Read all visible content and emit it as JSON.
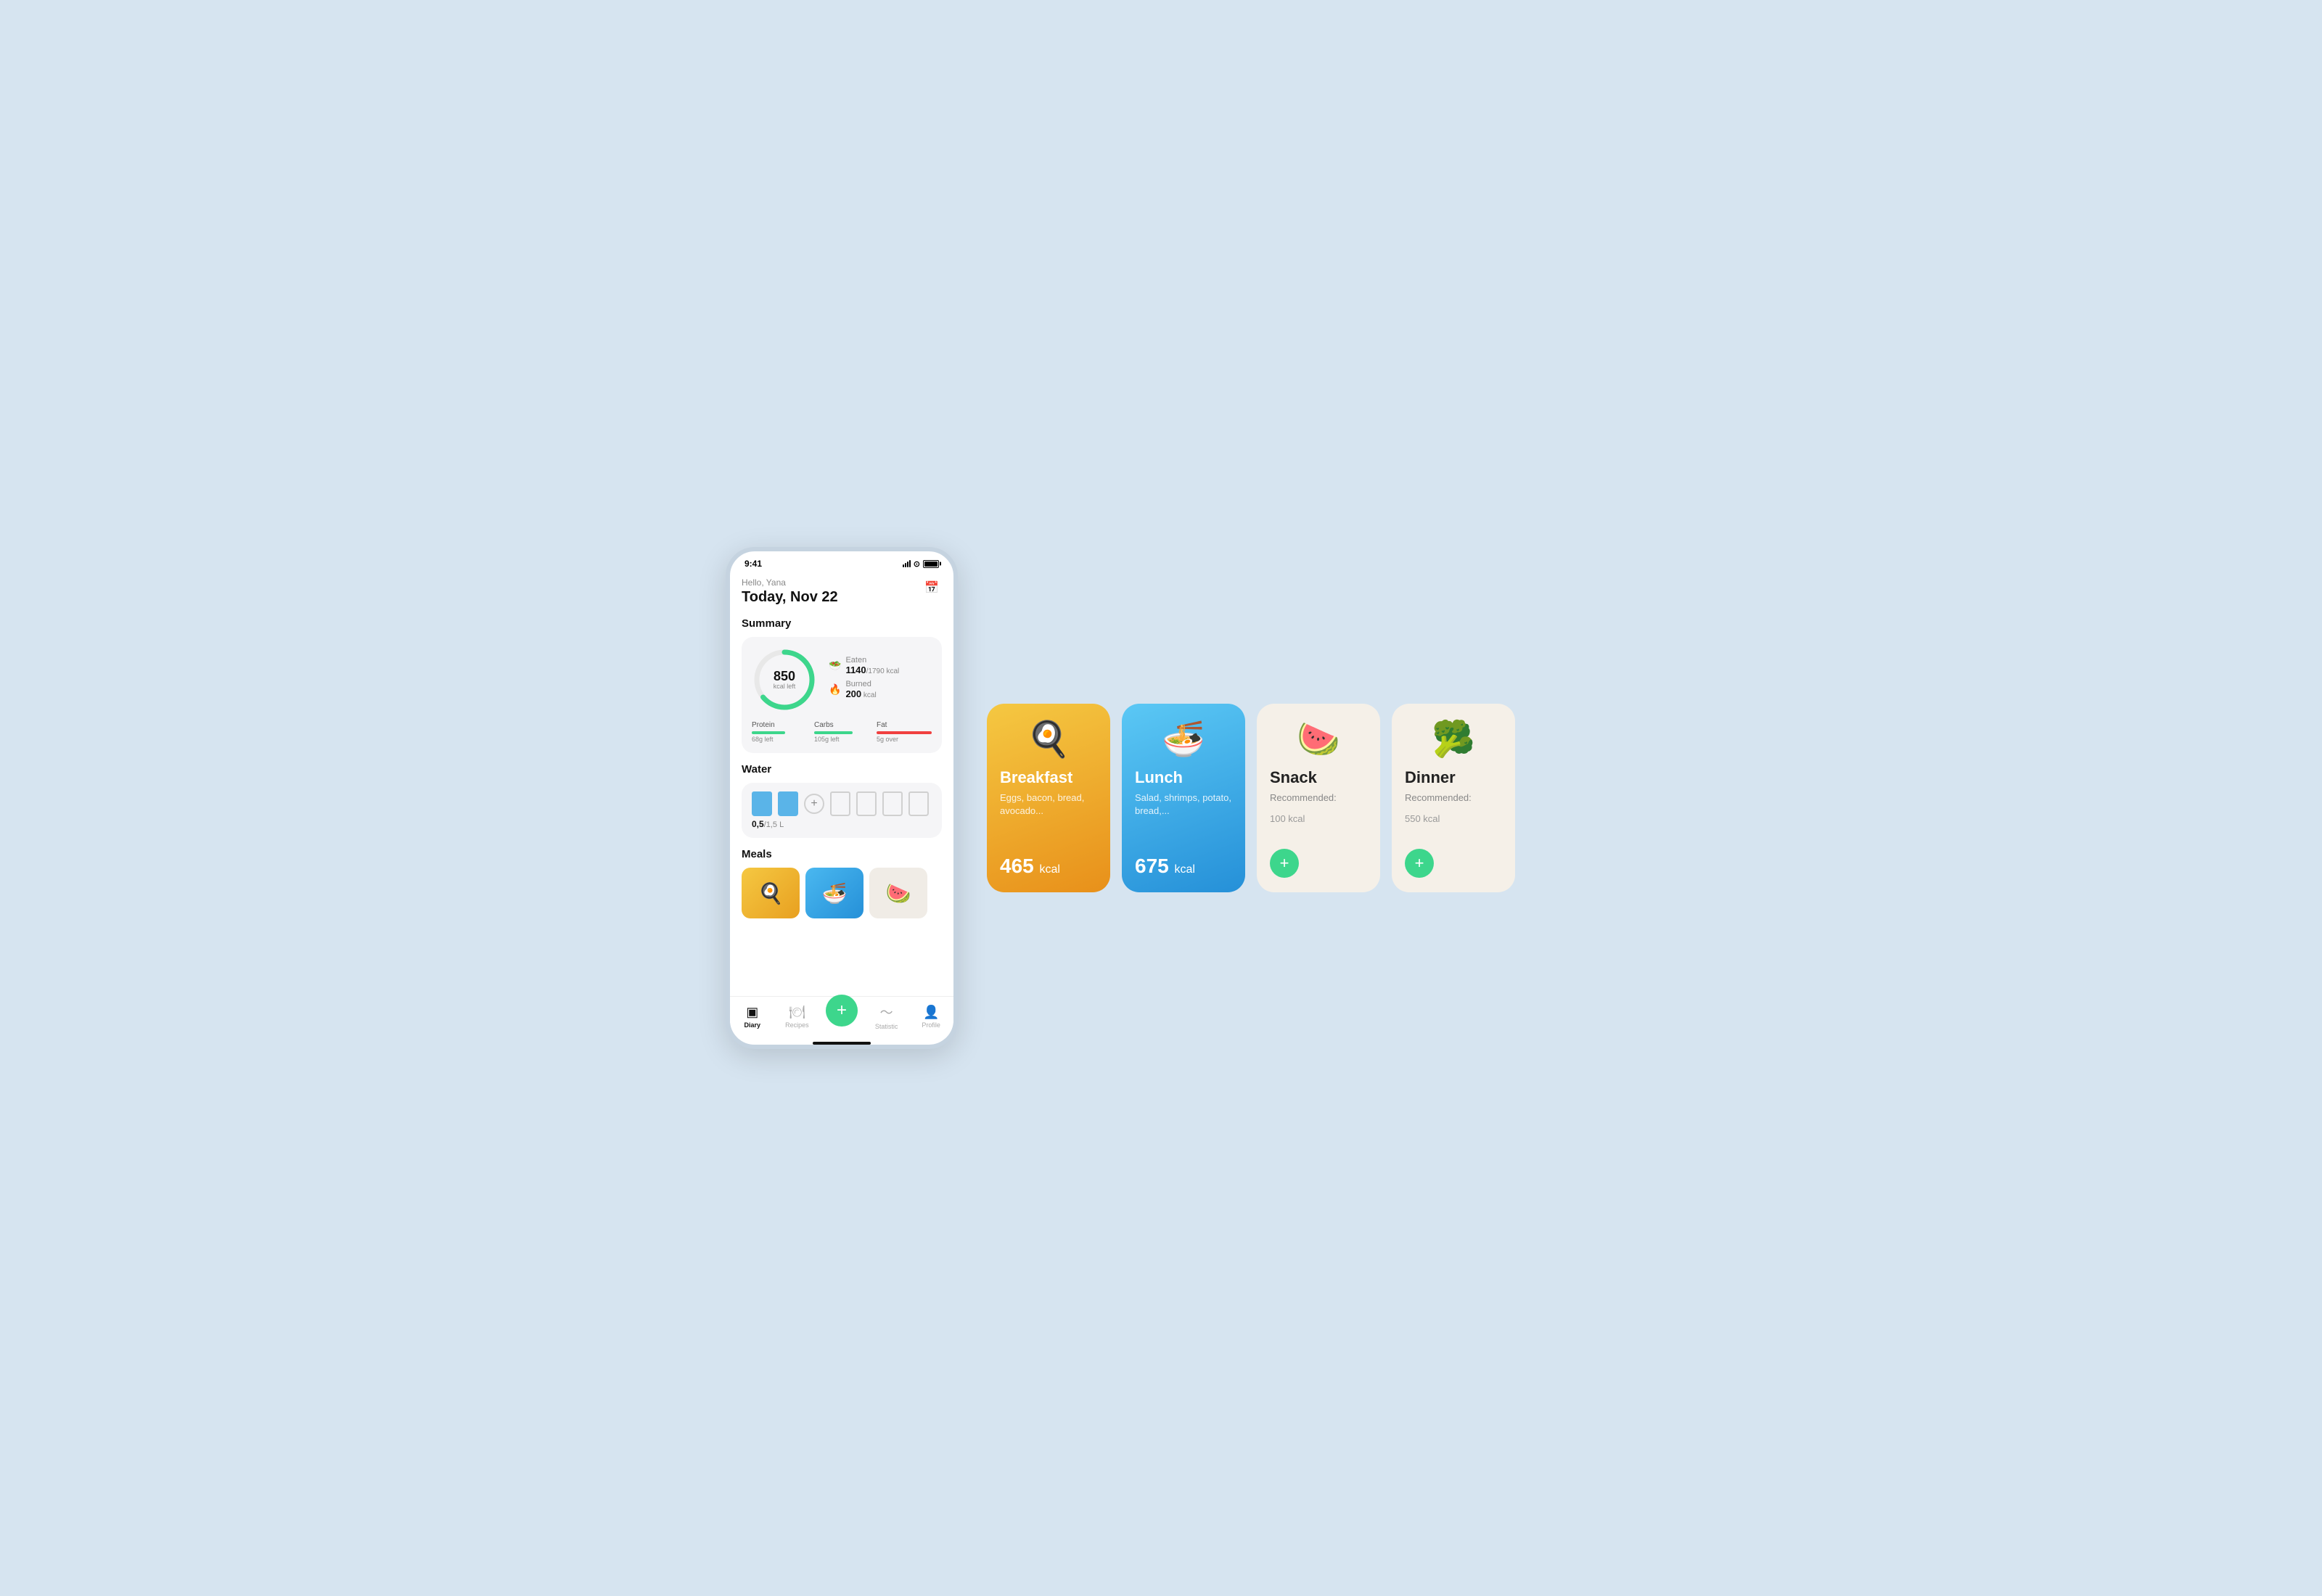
{
  "app": {
    "background_color": "#d6e4f0"
  },
  "status_bar": {
    "time": "9:41",
    "signal": "signal",
    "wifi": "wifi",
    "battery": "battery"
  },
  "header": {
    "greeting": "Hello, Yana",
    "date": "Today, Nov 22"
  },
  "summary": {
    "section_title": "Summary",
    "kcal_left": "850",
    "kcal_left_label": "kcal left",
    "eaten_label": "Eaten",
    "eaten_value": "1140",
    "eaten_total": "1790",
    "eaten_unit": "kcal",
    "burned_label": "Burned",
    "burned_value": "200",
    "burned_unit": "kcal",
    "donut_progress": 64,
    "macros": [
      {
        "name": "Protein",
        "color": "#3dd68c",
        "left": "68g left",
        "progress": 60
      },
      {
        "name": "Carbs",
        "color": "#3dd68c",
        "left": "105g left",
        "progress": 70
      },
      {
        "name": "Fat",
        "color": "#f04040",
        "left": "5g over",
        "progress": 105
      }
    ]
  },
  "water": {
    "section_title": "Water",
    "glasses_filled": 2,
    "glasses_total": 6,
    "current": "0,5",
    "total": "1,5",
    "unit": "L"
  },
  "meals": {
    "section_title": "Meals"
  },
  "bottom_nav": {
    "items": [
      {
        "id": "diary",
        "label": "Diary",
        "icon": "📓",
        "active": true
      },
      {
        "id": "recipes",
        "label": "Recipes",
        "icon": "🍽️",
        "active": false
      },
      {
        "id": "add",
        "label": "",
        "icon": "+",
        "active": false
      },
      {
        "id": "statistic",
        "label": "Statistic",
        "icon": "📈",
        "active": false
      },
      {
        "id": "profile",
        "label": "Profile",
        "icon": "👤",
        "active": false
      }
    ]
  },
  "meal_cards": [
    {
      "id": "breakfast",
      "title": "Breakfast",
      "emoji": "🍳",
      "description": "Eggs, bacon, bread, avocado...",
      "kcal": "465",
      "kcal_unit": "kcal",
      "type": "colored",
      "gradient": "breakfast"
    },
    {
      "id": "lunch",
      "title": "Lunch",
      "emoji": "🍜",
      "description": "Salad, shrimps, potato, bread,...",
      "kcal": "675",
      "kcal_unit": "kcal",
      "type": "colored",
      "gradient": "lunch"
    },
    {
      "id": "snack",
      "title": "Snack",
      "emoji": "🍉",
      "description": "Recommended:",
      "recommended_kcal": "100 kcal",
      "type": "light"
    },
    {
      "id": "dinner",
      "title": "Dinner",
      "emoji": "🥦",
      "description": "Recommended:",
      "recommended_kcal": "550 kcal",
      "type": "light"
    }
  ]
}
